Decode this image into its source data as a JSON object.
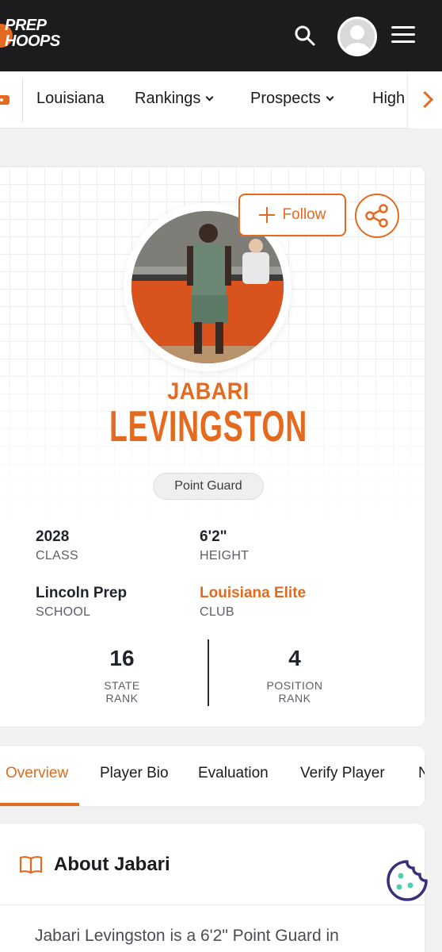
{
  "brand": {
    "line1": "PREP",
    "line2": "HOOPS",
    "accent": "#e36a1e"
  },
  "header": {
    "search_icon": "search-icon",
    "menu_icon": "hamburger-menu-icon"
  },
  "subnav": {
    "items": [
      {
        "label": "Louisiana",
        "dropdown": false
      },
      {
        "label": "Rankings",
        "dropdown": true
      },
      {
        "label": "Prospects",
        "dropdown": true
      },
      {
        "label": "High",
        "dropdown": false
      }
    ]
  },
  "profile": {
    "follow_label": "Follow",
    "first_name": "JABARI",
    "last_name": "LEVINGSTON",
    "position": "Point Guard",
    "class_value": "2028",
    "class_label": "CLASS",
    "height_value": "6'2\"",
    "height_label": "HEIGHT",
    "school_value": "Lincoln Prep",
    "school_label": "SCHOOL",
    "club_value": "Louisiana Elite",
    "club_label": "CLUB",
    "state_rank_value": "16",
    "state_rank_label_1": "STATE",
    "state_rank_label_2": "RANK",
    "position_rank_value": "4",
    "position_rank_label_1": "POSITION",
    "position_rank_label_2": "RANK"
  },
  "tabs": {
    "items": [
      "Overview",
      "Player Bio",
      "Evaluation",
      "Verify Player",
      "N"
    ],
    "active": "Overview"
  },
  "about": {
    "title": "About Jabari",
    "text": "Jabari Levingston is a 6'2\" Point Guard in"
  }
}
